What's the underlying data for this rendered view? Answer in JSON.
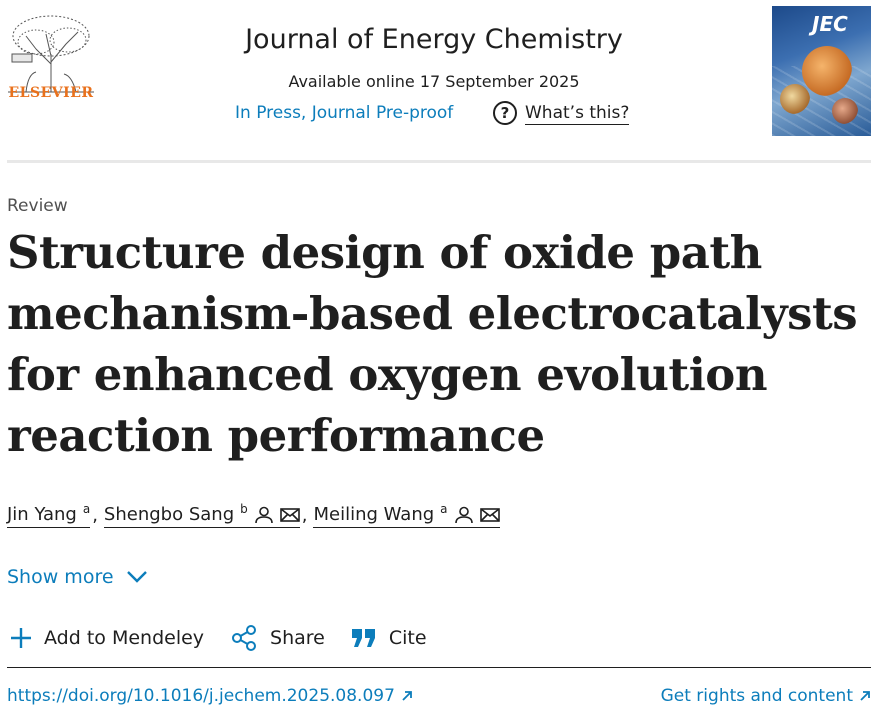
{
  "header": {
    "publisher": "ELSEVIER",
    "journal_title": "Journal of Energy Chemistry",
    "available_online": "Available online 17 September 2025",
    "status_link": "In Press, Journal Pre-proof",
    "whats_this": "What’s this?",
    "cover_logo": "JEC"
  },
  "article": {
    "type": "Review",
    "title": "Structure design of oxide path mechanism-based electrocatalysts for enhanced oxygen evolution reaction performance",
    "authors": [
      {
        "name": "Jin Yang",
        "affil": "a"
      },
      {
        "name": "Shengbo Sang",
        "affil": "b"
      },
      {
        "name": "Meiling Wang",
        "affil": "a"
      }
    ],
    "show_more": "Show more"
  },
  "actions": {
    "add_mendeley": "Add to Mendeley",
    "share": "Share",
    "cite": "Cite"
  },
  "footer": {
    "doi": "https://doi.org/10.1016/j.jechem.2025.08.097",
    "rights": "Get rights and content"
  },
  "colors": {
    "link": "#0c7dbb",
    "elsevier_orange": "#e9711c",
    "text": "#1f1f1f"
  }
}
